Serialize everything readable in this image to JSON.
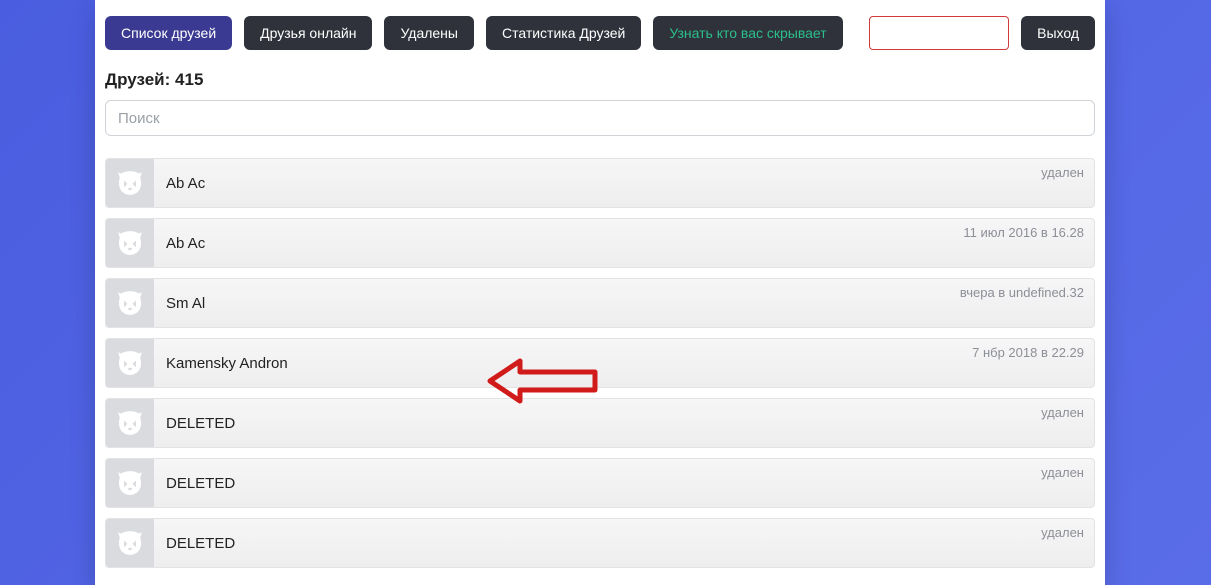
{
  "toolbar": {
    "friends_list": "Список друзей",
    "friends_online": "Друзья онлайн",
    "deleted": "Удалены",
    "friends_stats": "Статистика Друзей",
    "who_hides": "Узнать кто вас скрывает",
    "logout": "Выход",
    "code_value": ""
  },
  "counter": {
    "label": "Друзей: ",
    "value": "415"
  },
  "search": {
    "placeholder": "Поиск",
    "value": ""
  },
  "rows": [
    {
      "name": "Ab Ac",
      "status": "удален"
    },
    {
      "name": "Ab Ac",
      "status": "11 июл 2016 в 16.28"
    },
    {
      "name": "Sm Al",
      "status": "вчера в undefined.32"
    },
    {
      "name": "Kamensky Andron",
      "status": "7 нбр 2018 в 22.29"
    },
    {
      "name": "DELETED",
      "status": "удален"
    },
    {
      "name": "DELETED",
      "status": "удален"
    },
    {
      "name": "DELETED",
      "status": "удален"
    }
  ]
}
